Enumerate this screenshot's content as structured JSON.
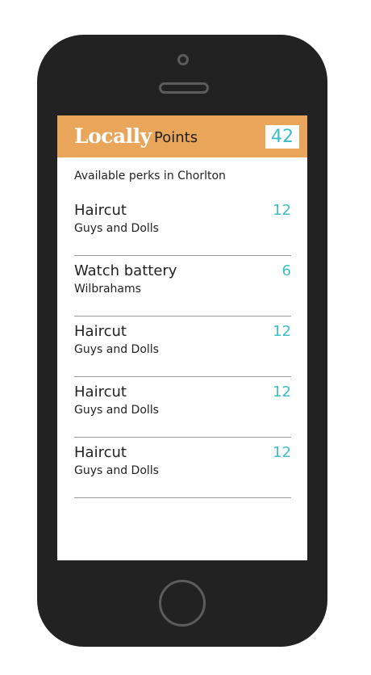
{
  "header": {
    "brand": "Locally",
    "points_label": "Points",
    "points_total": "42"
  },
  "subtitle": "Available perks in Chorlton",
  "perks": [
    {
      "name": "Haircut",
      "merchant": "Guys and Dolls",
      "points": "12"
    },
    {
      "name": "Watch battery",
      "merchant": "Wilbrahams",
      "points": "6"
    },
    {
      "name": "Haircut",
      "merchant": "Guys and Dolls",
      "points": "12"
    },
    {
      "name": "Haircut",
      "merchant": "Guys and Dolls",
      "points": "12"
    },
    {
      "name": "Haircut",
      "merchant": "Guys and Dolls",
      "points": "12"
    }
  ],
  "colors": {
    "header_bg": "#e9a55a",
    "accent": "#3bbec9",
    "phone_body": "#222222"
  }
}
